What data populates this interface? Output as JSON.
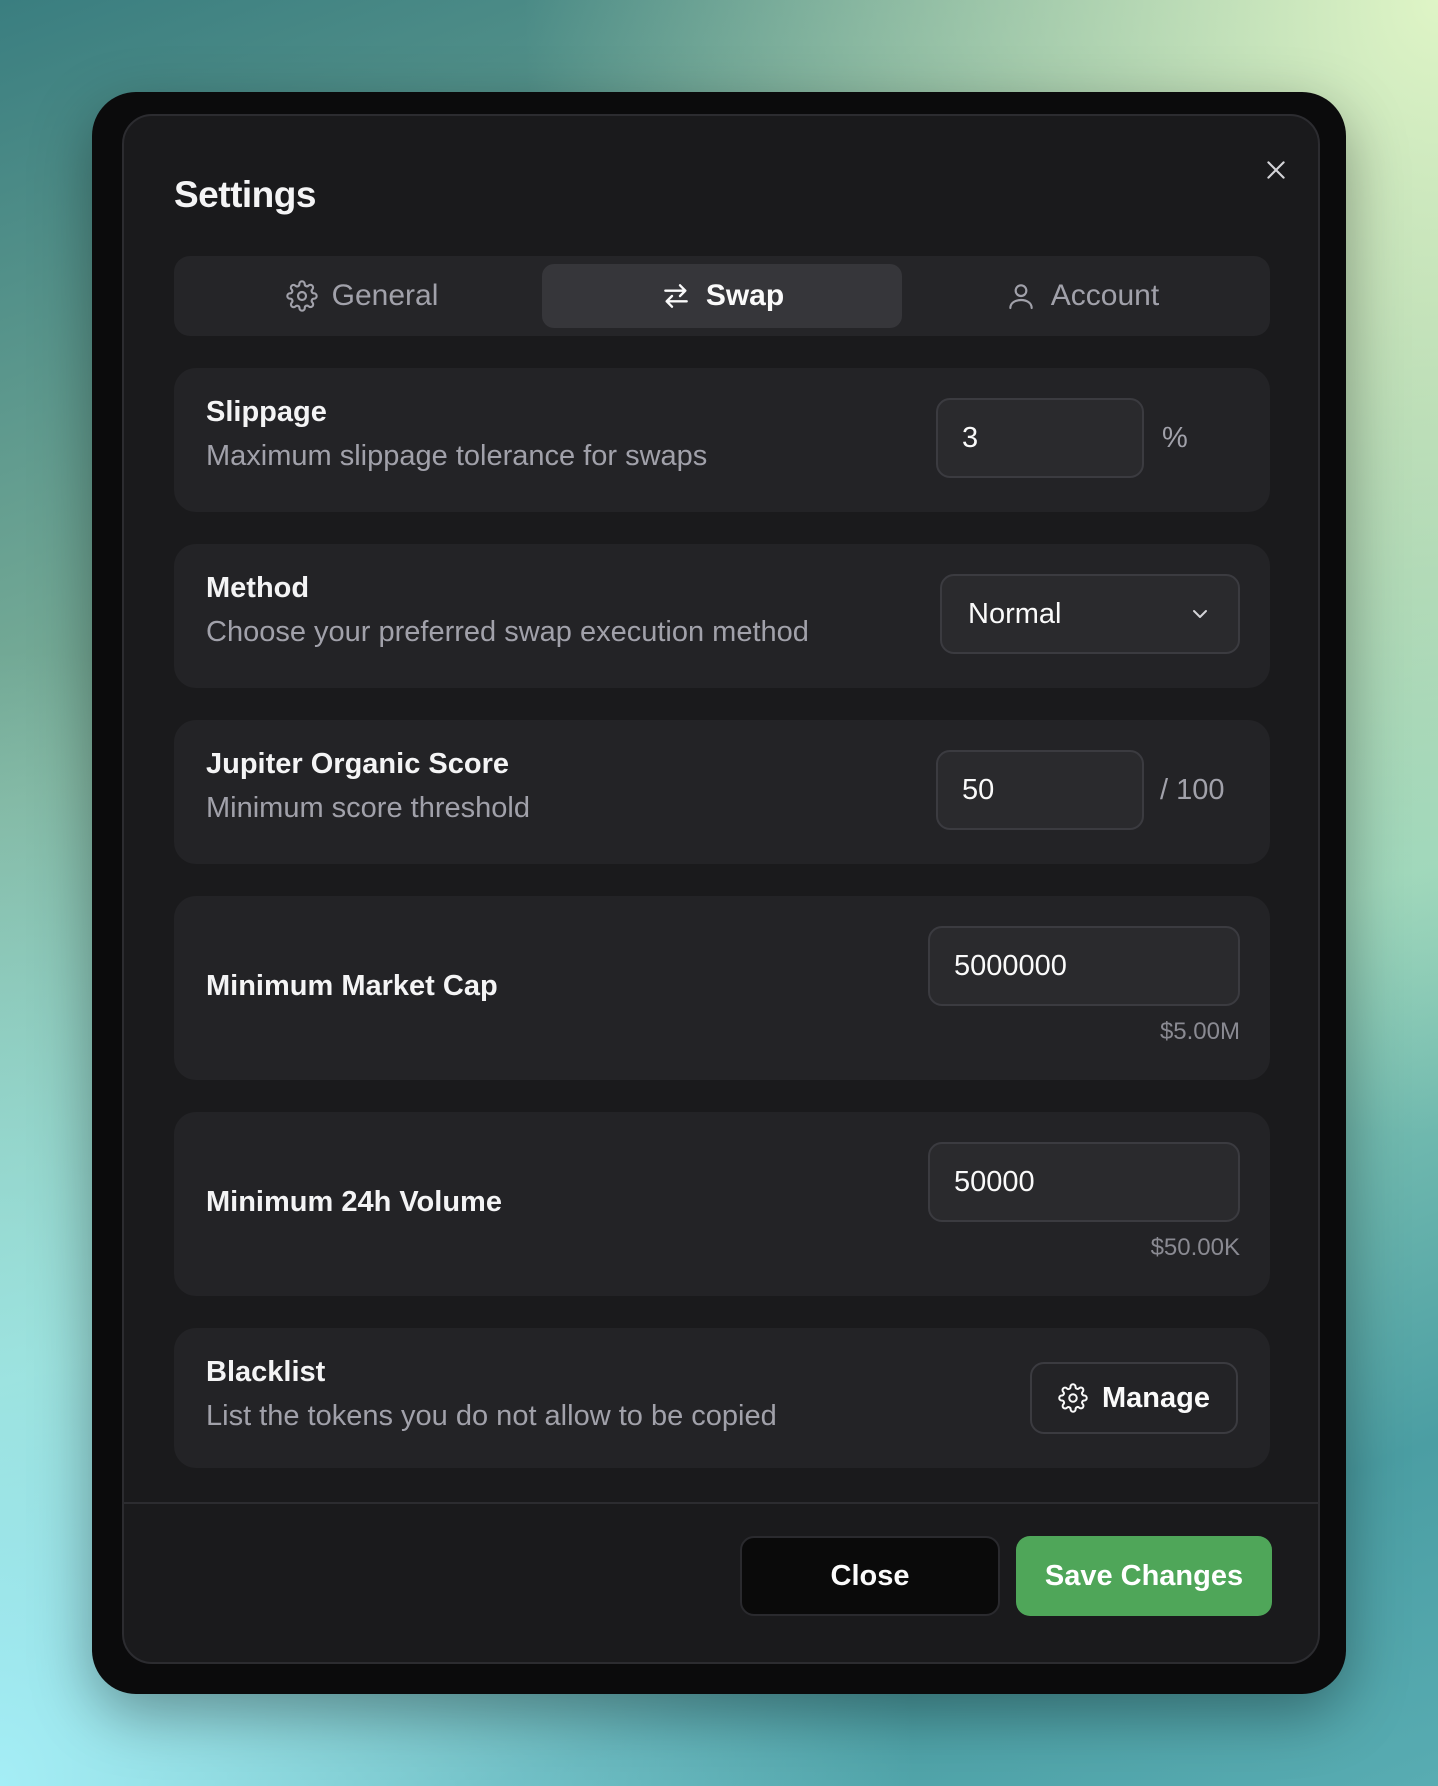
{
  "dialog": {
    "title": "Settings",
    "close_icon": "close-icon"
  },
  "tabs": [
    {
      "label": "General",
      "icon": "gear-icon",
      "active": false
    },
    {
      "label": "Swap",
      "icon": "swap-arrows-icon",
      "active": true
    },
    {
      "label": "Account",
      "icon": "user-icon",
      "active": false
    }
  ],
  "settings": {
    "slippage": {
      "label": "Slippage",
      "description": "Maximum slippage tolerance for swaps",
      "value": "3",
      "suffix": "%"
    },
    "method": {
      "label": "Method",
      "description": "Choose your preferred swap execution method",
      "selected": "Normal"
    },
    "organic_score": {
      "label": "Jupiter Organic Score",
      "description": "Minimum score threshold",
      "value": "50",
      "suffix": "/ 100"
    },
    "market_cap": {
      "label": "Minimum Market Cap",
      "value": "5000000",
      "formatted": "$5.00M"
    },
    "volume": {
      "label": "Minimum 24h Volume",
      "value": "50000",
      "formatted": "$50.00K"
    },
    "blacklist": {
      "label": "Blacklist",
      "description": "List the tokens you do not allow to be copied",
      "button": "Manage"
    }
  },
  "footer": {
    "close_label": "Close",
    "save_label": "Save Changes"
  },
  "colors": {
    "accent": "#4fa659",
    "background": "#1a1a1c",
    "card": "#232326"
  }
}
